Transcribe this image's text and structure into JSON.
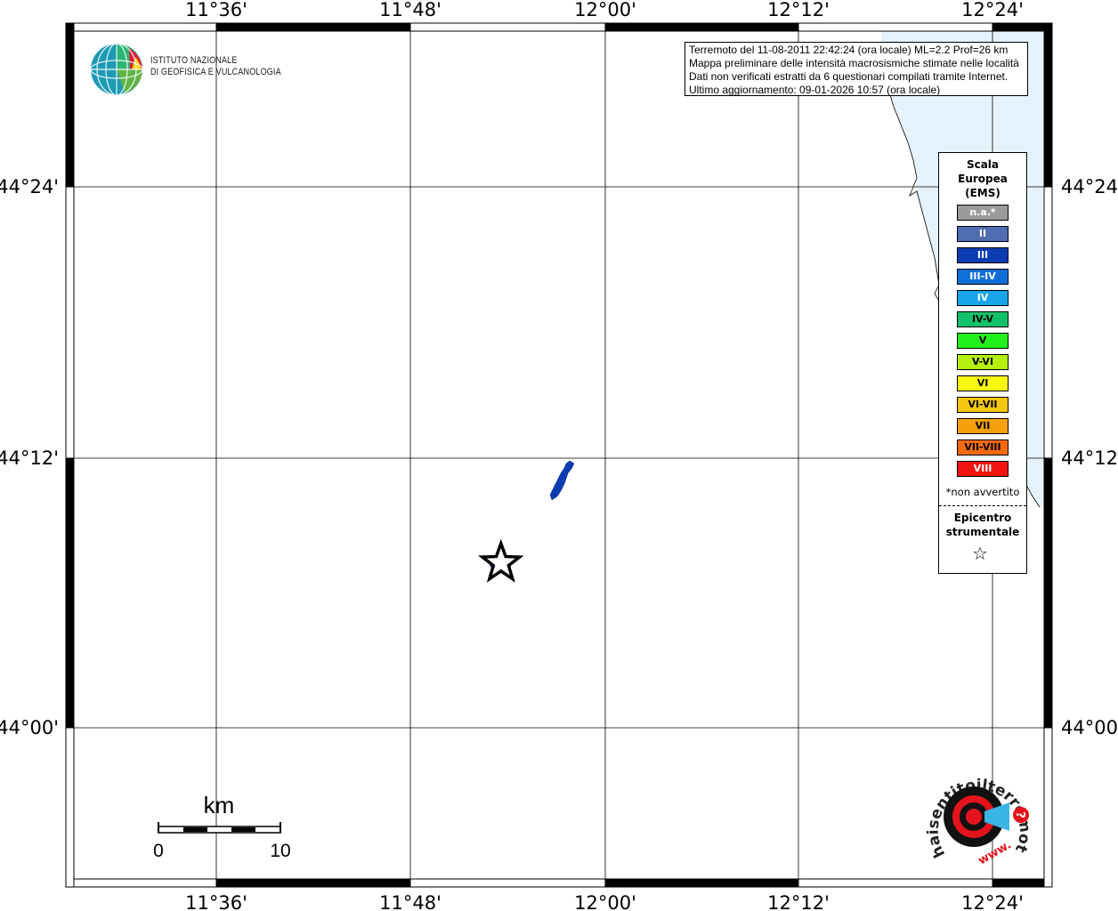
{
  "map": {
    "lon_ticks": [
      "11°36'",
      "11°48'",
      "12°00'",
      "12°12'",
      "12°24'"
    ],
    "lat_ticks": [
      "44°24'",
      "44°12'",
      "44°00'"
    ],
    "lon_range": [
      11.46,
      12.48
    ],
    "lat_range": [
      43.93,
      44.53
    ],
    "epicenter": {
      "lon": 11.91,
      "lat": 44.155
    },
    "colors": {
      "sea": "#e6f2fb",
      "frame": "#000000",
      "grid": "#000000",
      "intensity_iii": "#0a3cb4"
    }
  },
  "info": {
    "line1": "Terremoto del 11-08-2011 22:42:24 (ora locale) ML=2.2 Prof=26 km",
    "line2": "Mappa preliminare delle intensità macrosismiche stimate nelle località",
    "line3": "Dati non verificati estratti da 6 questionari compilati tramite Internet.",
    "line4": "Ultimo aggiornamento: 09-01-2026 10:57 (ora locale)"
  },
  "logo": {
    "line1": "ISTITUTO NAZIONALE",
    "line2": "DI GEOFISICA E VULCANOLOGIA"
  },
  "legend": {
    "title1": "Scala",
    "title2": "Europea",
    "title3": "(EMS)",
    "items": [
      {
        "label": "n.a.*",
        "color": "#9b9b9b",
        "text": "#ffffff"
      },
      {
        "label": "II",
        "color": "#4f6db0",
        "text": "#ffffff"
      },
      {
        "label": "III",
        "color": "#0a3cb4",
        "text": "#ffffff"
      },
      {
        "label": "III-IV",
        "color": "#0f6fd8",
        "text": "#ffffff"
      },
      {
        "label": "IV",
        "color": "#19a6e8",
        "text": "#ffffff"
      },
      {
        "label": "IV-V",
        "color": "#12c26a",
        "text": "#000000"
      },
      {
        "label": "V",
        "color": "#22f01e",
        "text": "#000000"
      },
      {
        "label": "V-VI",
        "color": "#b6f00e",
        "text": "#000000"
      },
      {
        "label": "VI",
        "color": "#f6f60e",
        "text": "#000000"
      },
      {
        "label": "VI-VII",
        "color": "#f6c50e",
        "text": "#000000"
      },
      {
        "label": "VII",
        "color": "#f6a00e",
        "text": "#000000"
      },
      {
        "label": "VII-VIII",
        "color": "#f66a0e",
        "text": "#000000"
      },
      {
        "label": "VIII",
        "color": "#f2140e",
        "text": "#ffffff"
      }
    ],
    "note": "*non avvertito",
    "epi1": "Epicentro",
    "epi2": "strumentale",
    "epi_icon": "☆"
  },
  "scalebar": {
    "unit": "km",
    "start": "0",
    "end": "10"
  },
  "hst": {
    "text": "haisentitoilterremoto.it",
    "prefix": "www.",
    "mark": "?"
  }
}
